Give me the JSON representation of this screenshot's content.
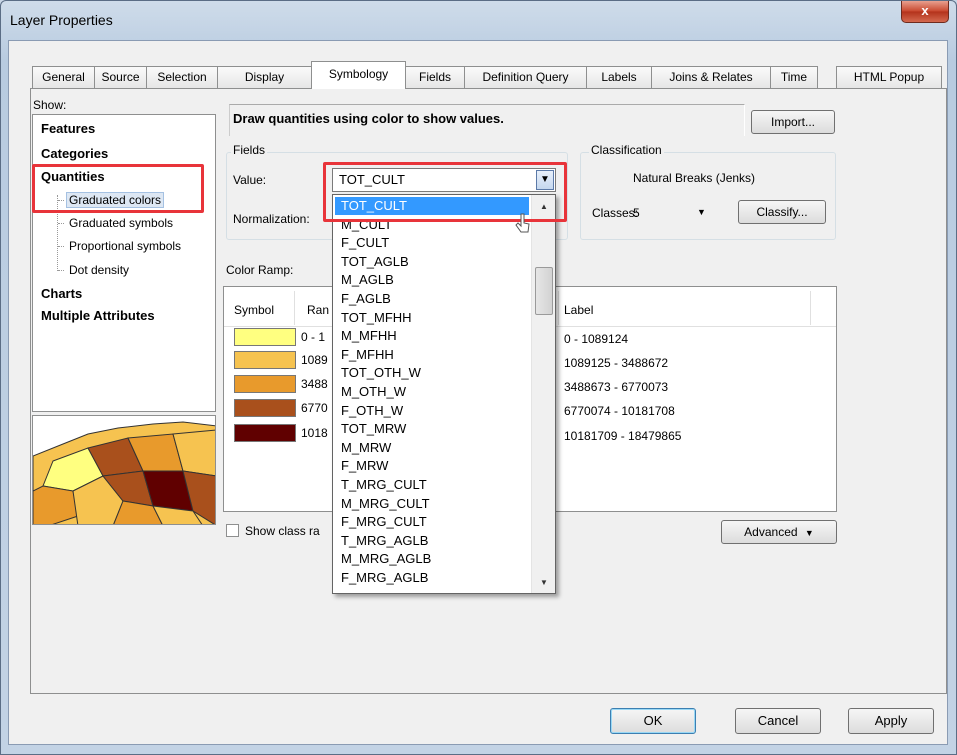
{
  "window": {
    "title": "Layer Properties",
    "close_label": "x"
  },
  "tabs": [
    "General",
    "Source",
    "Selection",
    "Display",
    "Symbology",
    "Fields",
    "Definition Query",
    "Labels",
    "Joins & Relates",
    "Time",
    "HTML Popup"
  ],
  "active_tab": "Symbology",
  "show": {
    "label": "Show:",
    "items": {
      "features": "Features",
      "categories": "Categories",
      "quantities": "Quantities",
      "graduated_colors": "Graduated colors",
      "graduated_symbols": "Graduated symbols",
      "proportional_symbols": "Proportional symbols",
      "dot_density": "Dot density",
      "charts": "Charts",
      "multiple_attributes": "Multiple Attributes"
    },
    "selected": "Graduated colors"
  },
  "description": "Draw quantities using color to show values.",
  "import_label": "Import...",
  "fields": {
    "group_label": "Fields",
    "value_label": "Value:",
    "value": "TOT_CULT",
    "normalization_label": "Normalization:"
  },
  "classification": {
    "group_label": "Classification",
    "method": "Natural Breaks (Jenks)",
    "classes_label": "Classes:",
    "classes_value": "5",
    "classify_label": "Classify..."
  },
  "color_ramp_label": "Color Ramp:",
  "symbol_table": {
    "headers": {
      "symbol": "Symbol",
      "range": "Ran",
      "label": "Label"
    },
    "rows": [
      {
        "color": "#ffff80",
        "range": "0 - 1",
        "label": "0 - 1089124"
      },
      {
        "color": "#f6c350",
        "range": "1089",
        "label": "1089125 - 3488672"
      },
      {
        "color": "#e89a2c",
        "range": "3488",
        "label": "3488673 - 6770073"
      },
      {
        "color": "#a9501c",
        "range": "6770",
        "label": "6770074 - 10181708"
      },
      {
        "color": "#600000",
        "range": "1018",
        "label": "10181709 - 18479865"
      }
    ]
  },
  "show_class_ranges_label": "Show class ra",
  "advanced_label": "Advanced",
  "dropdown_options": [
    "TOT_CULT",
    "M_CULT",
    "F_CULT",
    "TOT_AGLB",
    "M_AGLB",
    "F_AGLB",
    "TOT_MFHH",
    "M_MFHH",
    "F_MFHH",
    "TOT_OTH_W",
    "M_OTH_W",
    "F_OTH_W",
    "TOT_MRW",
    "M_MRW",
    "F_MRW",
    "T_MRG_CULT",
    "M_MRG_CULT",
    "F_MRG_CULT",
    "T_MRG_AGLB",
    "M_MRG_AGLB",
    "F_MRG_AGLB"
  ],
  "dropdown_highlighted": "TOT_CULT",
  "buttons": {
    "ok": "OK",
    "cancel": "Cancel",
    "apply": "Apply"
  },
  "colors": {
    "highlight": "#3399ff",
    "callout": "#e8343a"
  }
}
